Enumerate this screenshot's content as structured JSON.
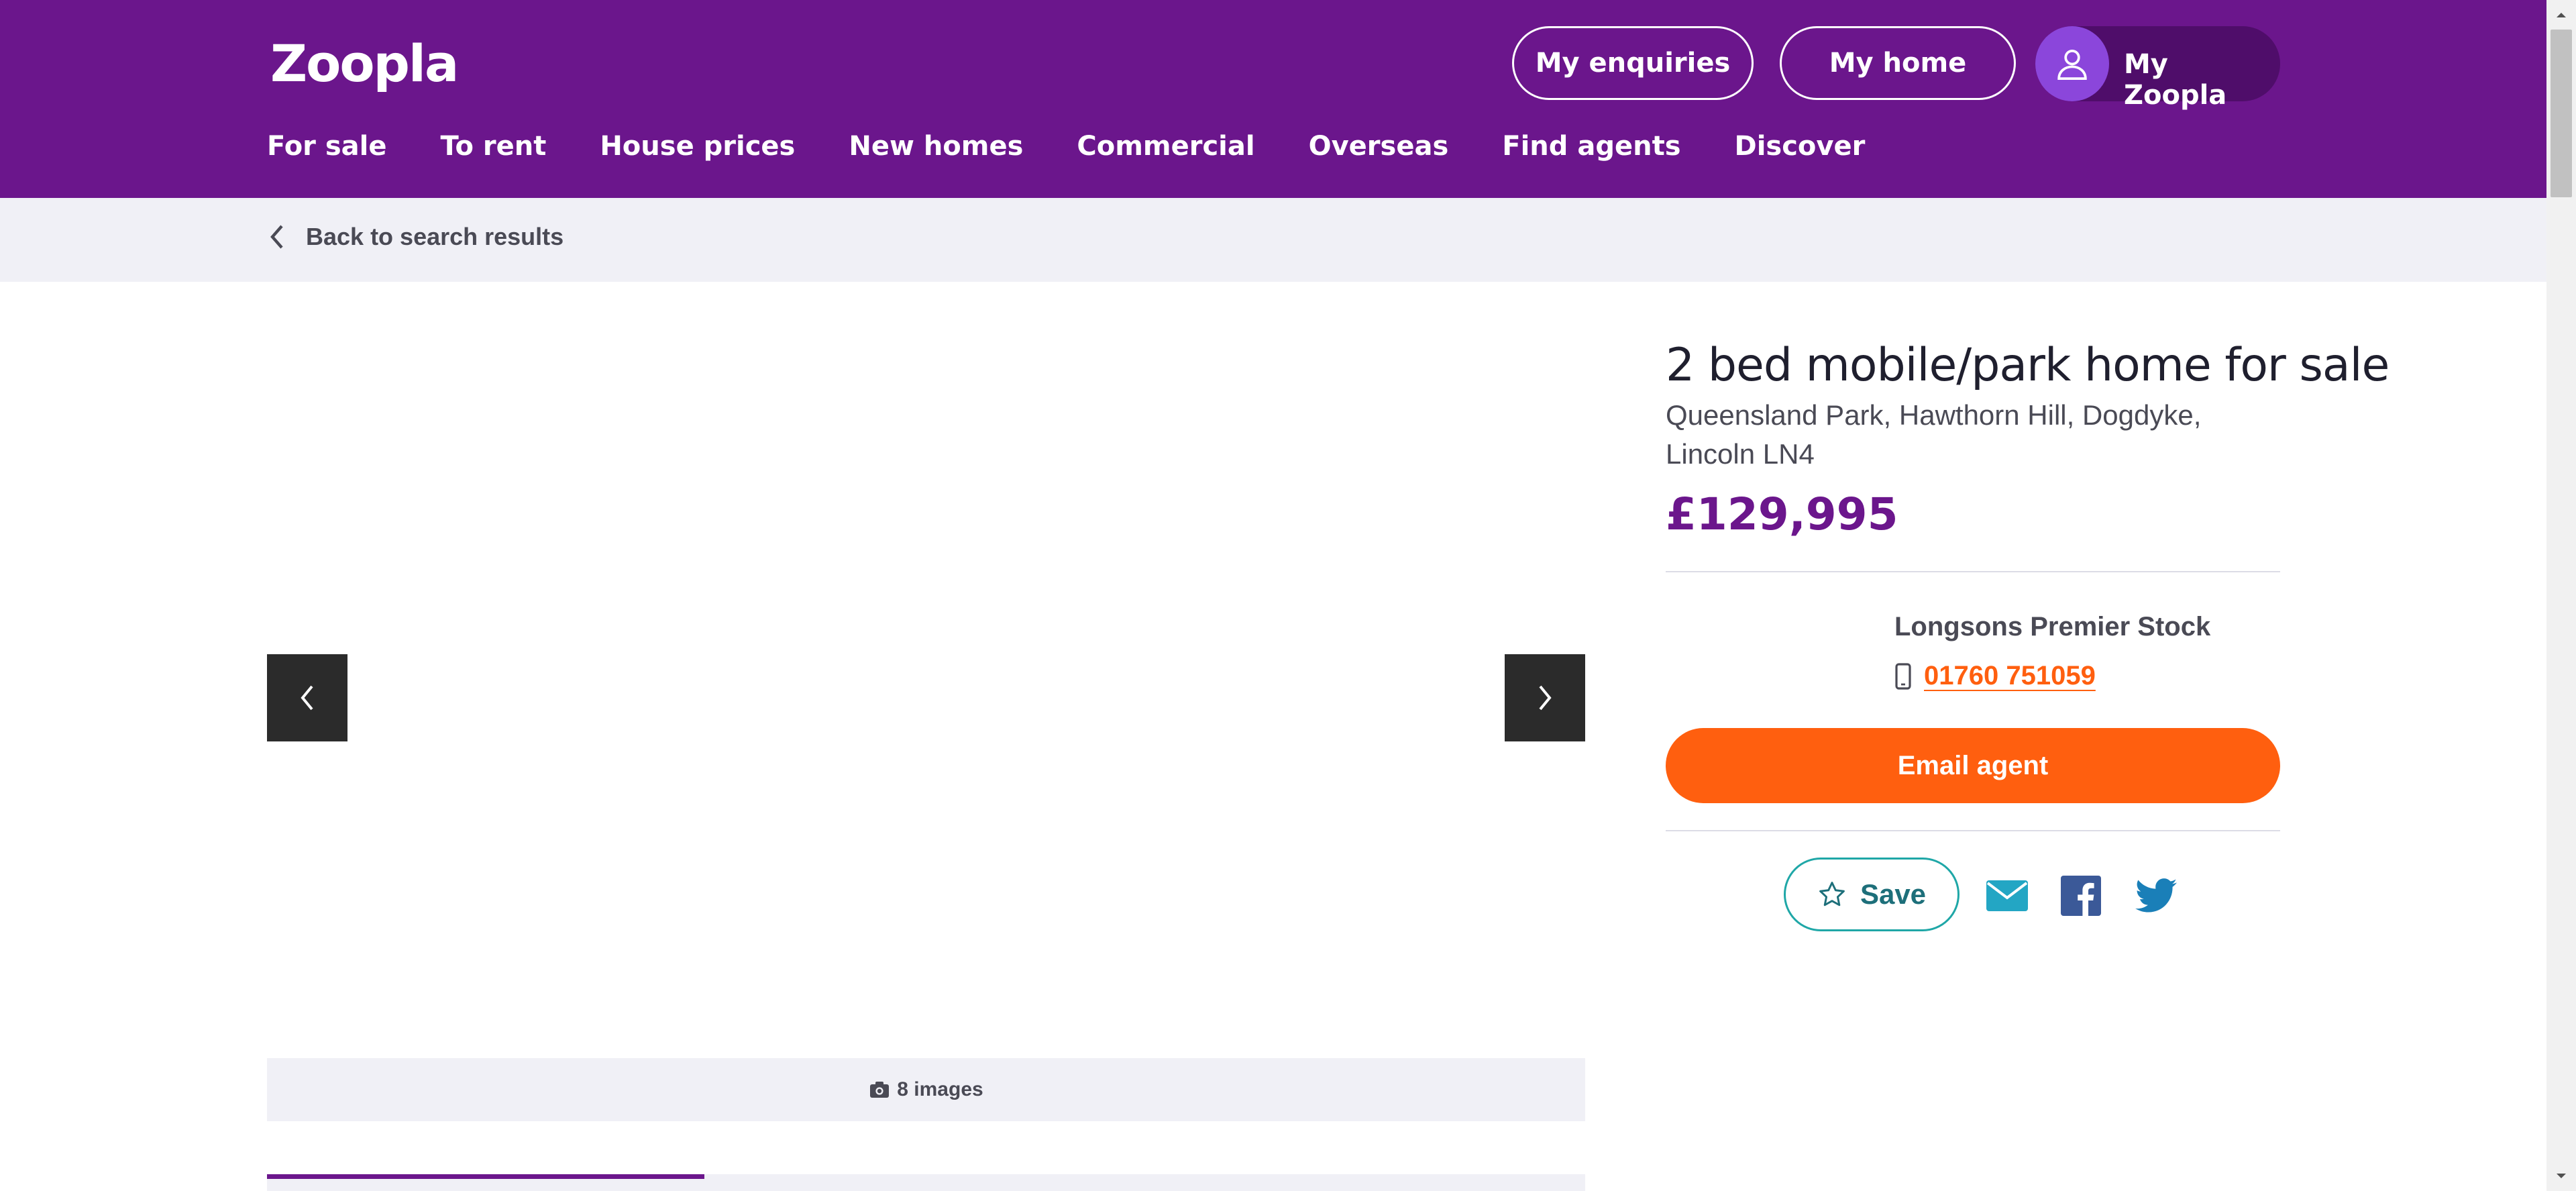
{
  "header": {
    "logo": "Zoopla",
    "enquiries_label": "My enquiries",
    "home_label": "My home",
    "myzoopla_label": "My Zoopla",
    "nav": [
      "For sale",
      "To rent",
      "House prices",
      "New homes",
      "Commercial",
      "Overseas",
      "Find agents",
      "Discover"
    ],
    "brand_color": "#6b168c"
  },
  "back": {
    "label": "Back to search results"
  },
  "gallery": {
    "image_count_label": "8 images"
  },
  "listing": {
    "title": "2 bed mobile/park home for sale",
    "address_line1": "Queensland Park, Hawthorn Hill, Dogdyke,",
    "address_line2": "Lincoln LN4",
    "price": "£129,995"
  },
  "agent": {
    "name": "Longsons Premier Stock",
    "phone": "01760 751059",
    "email_label": "Email agent",
    "cta_color": "#ff5f0f"
  },
  "actions": {
    "save_label": "Save",
    "share_icons": [
      "envelope-icon",
      "facebook-icon",
      "twitter-icon"
    ]
  }
}
